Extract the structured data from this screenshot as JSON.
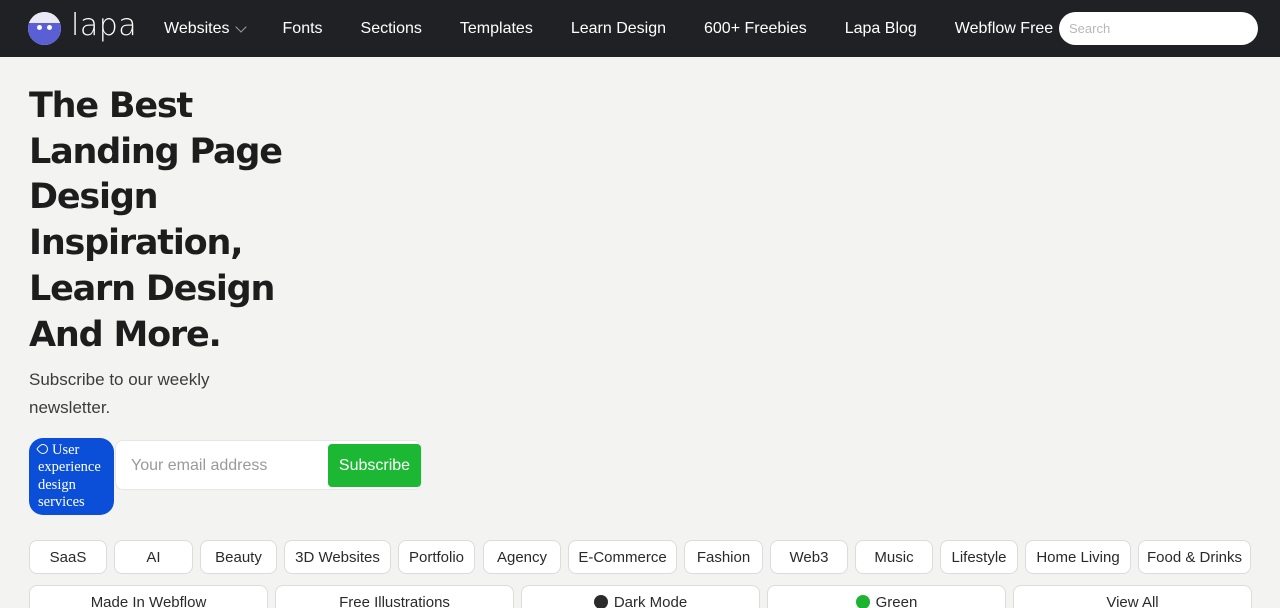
{
  "header": {
    "logo_text": "lapa",
    "nav": [
      "Websites",
      "Fonts",
      "Sections",
      "Templates",
      "Learn Design",
      "600+ Freebies",
      "Lapa Blog",
      "Webflow Free"
    ],
    "search_placeholder": "Search"
  },
  "hero": {
    "title_lines": [
      "The Best",
      "Landing Page",
      "Design",
      "Inspiration,",
      "Learn Design",
      "And More."
    ],
    "subtitle": "Subscribe to our weekly newsletter.",
    "tag_label": "User experience design services",
    "email_placeholder": "Your email address",
    "subscribe_label": "Subscribe"
  },
  "categories": [
    "SaaS",
    "AI",
    "Beauty",
    "3D Websites",
    "Portfolio",
    "Agency",
    "E-Commerce",
    "Fashion",
    "Web3",
    "Music",
    "Lifestyle",
    "Home Living",
    "Food & Drinks"
  ],
  "filters": [
    {
      "label": "Made In Webflow"
    },
    {
      "label": "Free Illustrations"
    },
    {
      "label": "Dark Mode",
      "dot_color": "#2b2b2b"
    },
    {
      "label": "Green",
      "dot_color": "#1fb332"
    },
    {
      "label": "View All"
    }
  ],
  "colors": {
    "topbar": "#202124",
    "accent_blue": "#0b4fd8",
    "accent_green": "#1cb733"
  }
}
